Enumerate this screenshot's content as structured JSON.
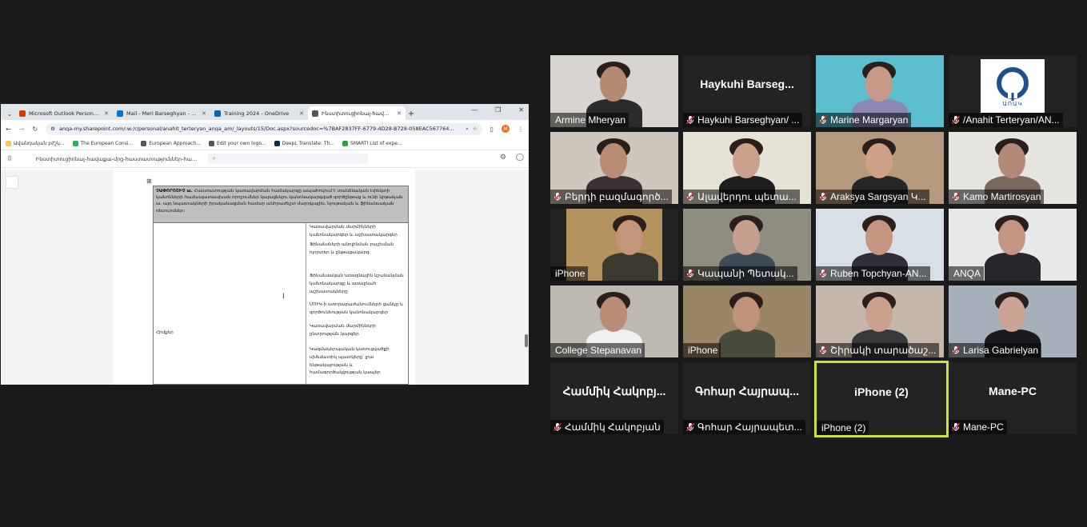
{
  "browser": {
    "tabs": [
      {
        "label": "Microsoft Outlook Personal Ema",
        "color": "#d83b01"
      },
      {
        "label": "Mail - Meri Barseghyan - Outlo",
        "color": "#0078d4"
      },
      {
        "label": "Training 2024 - OneDrive",
        "color": "#0364b8"
      },
      {
        "label": "Ինստիտուցիոնալ-հավաք...",
        "color": "#555555"
      }
    ],
    "url": "anqa-my.sharepoint.com/:w:/r/personal/anahit_terteryan_anqa_am/_layouts/15/Doc.aspx?sourcedoc=%7BAF2837FF-6779-4D28-B728-058EAC567764...",
    "profile_initial": "M",
    "bookmarks": [
      {
        "label": "Ավանդական բժշկ...",
        "color": "#f2c94c"
      },
      {
        "label": "The European Consi...",
        "color": "#27ae60"
      },
      {
        "label": "European Approach...",
        "color": "#555555"
      },
      {
        "label": "Edit your own logo...",
        "color": "#555555"
      },
      {
        "label": "DeepL Translate: Th...",
        "color": "#0f2b46"
      },
      {
        "label": "SMARTI List of expe...",
        "color": "#2e9d4a"
      }
    ],
    "doc_title": "Ինստիտուցիոնալ-հավաքա-մրց-հաստատություններ-համար-1-1 (1)",
    "search_placeholder": "",
    "table": {
      "header_bold": "ՉԱՓՈՐՈՇԻՉ ա.",
      "header_text": "Հաստատության կառավարման համակարգը ապահովում է տանձնական էփեկտի կանոնների համապատասխան որոշումներ կայացնելու կանոնակարգված գործընթաց և ունի կրթական ա. այդ նպատակների իրականացման համար անհրաժեշտ մարդկային, նյութական և ֆինանսական ռեսուրսներ:",
      "items": [
        "Կառավարման մարմինների կանոնակարգեր և աշխատակարգեր",
        "Ֆինանսների անոլինման բաշխման ոլորտեր և ընթացակարգ",
        "Ֆինանսական առաջնային նշանակման կանոնակարգը և առաջնահ աշխատակները",
        "ՄՈՒԿ-ի ստորաբաժանումների ցանկը և գործունեության կանոնակարգեր",
        "Կառավարման մարմինների ընտրության կարգեր",
        "Կազմակերպական կառուցվածքի սխեմատիկ պատկերը՝ լրա ենթակայության և համագործակցության կապեր"
      ],
      "row_label": "Հիմքեր"
    }
  },
  "gallery": [
    {
      "display_name": "Armine Mheryan",
      "big_label": "",
      "muted": false,
      "video": true,
      "bg": "#d8d4cf",
      "skin": "#b58a72",
      "shirt": "#2b2b2b"
    },
    {
      "display_name": "Haykuhi Barseghyan/ ...",
      "big_label": "Haykuhi  Barseg...",
      "muted": true,
      "video": false
    },
    {
      "display_name": "Marine Margaryan",
      "big_label": "",
      "muted": true,
      "video": true,
      "bg": "#5bbfd0",
      "skin": "#c79a88",
      "shirt": "#8d87b3"
    },
    {
      "display_name": "/Anahit Terteryan/AN...",
      "big_label": "",
      "muted": true,
      "video": false,
      "logo": true,
      "logo_text": "ԱՈԱԿ"
    },
    {
      "display_name": "Բերդի բազմագործ...",
      "big_label": "",
      "muted": true,
      "video": true,
      "bg": "#cfc7bc",
      "skin": "#b98c74",
      "shirt": "#3a3032"
    },
    {
      "display_name": "Ալավերդու պետա...",
      "big_label": "",
      "muted": true,
      "video": true,
      "bg": "#e7e2d6",
      "skin": "#caa18b",
      "shirt": "#1e1e1e"
    },
    {
      "display_name": "Araksya Sargsyan Կ...",
      "big_label": "",
      "muted": true,
      "video": true,
      "bg": "#b59a7e",
      "skin": "#cf9f86",
      "shirt": "#262626"
    },
    {
      "display_name": "Kamo Martirosyan",
      "big_label": "",
      "muted": true,
      "video": true,
      "bg": "#e6e4df",
      "skin": "#b38a78",
      "shirt": "#7a6a5e"
    },
    {
      "display_name": "iPhone",
      "big_label": "",
      "muted": false,
      "video": true,
      "bg": "#b4935f",
      "skin": "#c3957b",
      "shirt": "#3c3a2f",
      "narrow": true
    },
    {
      "display_name": "Կապանի Պետակ...",
      "big_label": "",
      "muted": true,
      "video": true,
      "bg": "#8f8c80",
      "skin": "#c4a08c",
      "shirt": "#3e4a58"
    },
    {
      "display_name": "Ruben Topchyan-AN...",
      "big_label": "",
      "muted": true,
      "video": true,
      "bg": "#d9dfe6",
      "skin": "#c6957f",
      "shirt": "#2f2f3a"
    },
    {
      "display_name": "ANQA",
      "big_label": "",
      "muted": false,
      "video": true,
      "bg": "#e7e8e9",
      "skin": "#c29682",
      "shirt": "#26262b"
    },
    {
      "display_name": "College Stepanavan",
      "big_label": "",
      "muted": false,
      "video": true,
      "bg": "#bdb8b0",
      "skin": "#ba8d76",
      "shirt": "#f0f0f0"
    },
    {
      "display_name": "iPhone",
      "big_label": "",
      "muted": false,
      "video": true,
      "bg": "#9a8566",
      "skin": "#bf937a",
      "shirt": "#4a4a3c"
    },
    {
      "display_name": "Շիրակի տարածաշ...",
      "big_label": "",
      "muted": true,
      "video": true,
      "bg": "#c6b7ab",
      "skin": "#c9a08c",
      "shirt": "#38383a"
    },
    {
      "display_name": "Larisa Gabrielyan",
      "big_label": "",
      "muted": true,
      "video": true,
      "bg": "#a6b0bb",
      "skin": "#caa494",
      "shirt": "#1b1b1f"
    },
    {
      "display_name": "Համմիկ Հակոբյան",
      "big_label": "Համմիկ Հակոբյ...",
      "muted": true,
      "video": false
    },
    {
      "display_name": "Գոհար Հայրապետ...",
      "big_label": "Գոհար Հայրապ...",
      "muted": true,
      "video": false
    },
    {
      "display_name": "iPhone (2)",
      "big_label": "iPhone (2)",
      "muted": false,
      "video": false,
      "speaking": true
    },
    {
      "display_name": "Mane-PC",
      "big_label": "Mane-PC",
      "muted": true,
      "video": false
    }
  ]
}
